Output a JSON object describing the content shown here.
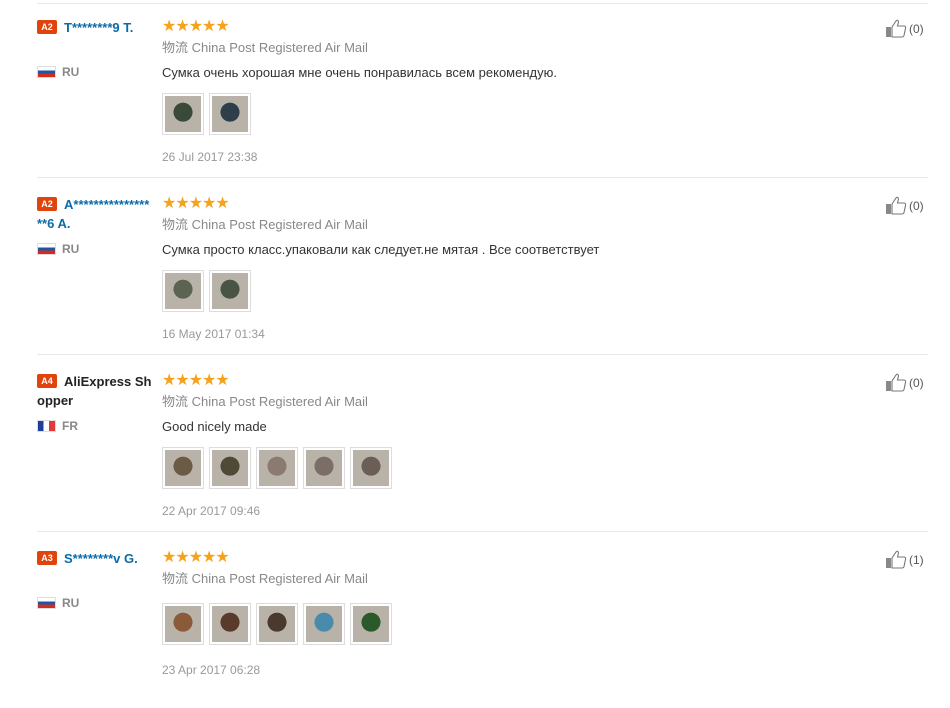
{
  "logistics_label": "物流 China Post Registered Air Mail",
  "stars": "★★★★★",
  "reviews": [
    {
      "badge": "A2",
      "name": "T********9 T.",
      "country": "RU",
      "flag": "ru",
      "text": "Сумка очень хорошая мне очень понравилась всем рекомендую.",
      "date": "26 Jul 2017 23:38",
      "helpful": "(0)",
      "photos": [
        "#3a4a3a",
        "#2e3e4a"
      ]
    },
    {
      "badge": "A2",
      "name": "A*****************6 A.",
      "country": "RU",
      "flag": "ru",
      "text": "Сумка просто класс.упаковали как следует.не мятая . Все соответствует",
      "date": "16 May 2017 01:34",
      "helpful": "(0)",
      "photos": [
        "#5a6450",
        "#4a5444"
      ]
    },
    {
      "badge": "A4",
      "name": "AliExpress Shopper",
      "country": "FR",
      "flag": "fr",
      "text": "Good nicely made",
      "date": "22 Apr 2017 09:46",
      "helpful": "(0)",
      "photos": [
        "#6b5a44",
        "#4e4a36",
        "#8a7a70",
        "#7a6e66",
        "#6a5e55"
      ]
    },
    {
      "badge": "A3",
      "name": "S********v G.",
      "country": "RU",
      "flag": "ru",
      "text": "",
      "date": "23 Apr 2017 06:28",
      "helpful": "(1)",
      "photos": [
        "#8a5a3a",
        "#5a3a2a",
        "#4a3a2e",
        "#4a8aaa",
        "#2a5a2a"
      ]
    }
  ]
}
